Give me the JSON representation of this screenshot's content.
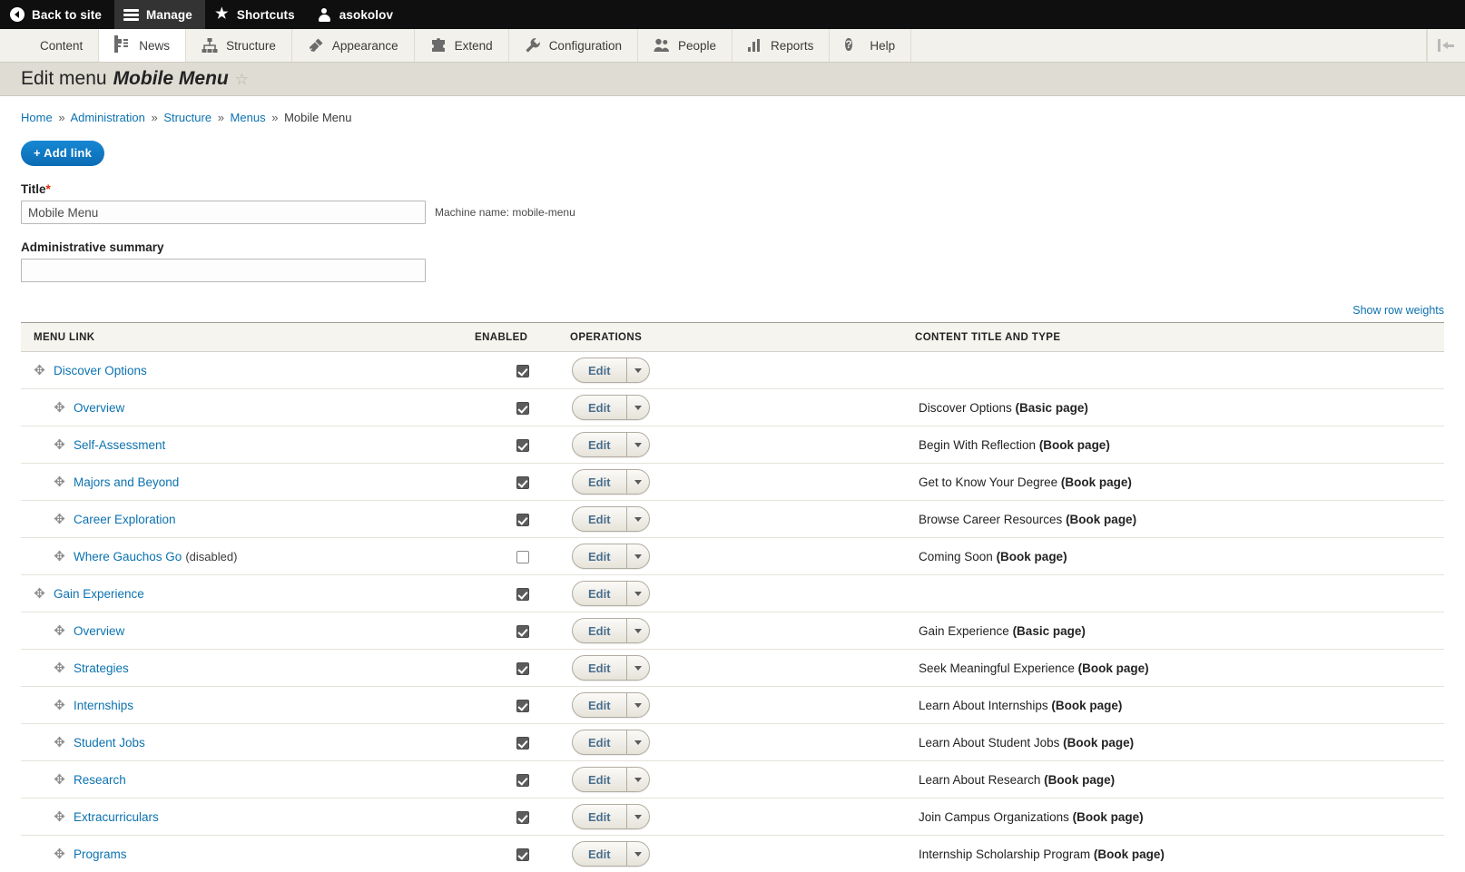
{
  "toolbar": {
    "back_to_site": "Back to site",
    "manage": "Manage",
    "shortcuts": "Shortcuts",
    "user": "asokolov"
  },
  "admin_menu": [
    {
      "label": "Content",
      "icon": "document-icon"
    },
    {
      "label": "News",
      "icon": "news-icon"
    },
    {
      "label": "Structure",
      "icon": "structure-icon"
    },
    {
      "label": "Appearance",
      "icon": "paintbrush-icon"
    },
    {
      "label": "Extend",
      "icon": "puzzle-icon"
    },
    {
      "label": "Configuration",
      "icon": "wrench-icon"
    },
    {
      "label": "People",
      "icon": "people-icon"
    },
    {
      "label": "Reports",
      "icon": "bar-chart-icon"
    },
    {
      "label": "Help",
      "icon": "help-icon"
    }
  ],
  "page": {
    "title_prefix": "Edit menu",
    "title_name": "Mobile Menu",
    "star": "☆"
  },
  "breadcrumb": [
    {
      "label": "Home",
      "link": true
    },
    {
      "label": "Administration",
      "link": true
    },
    {
      "label": "Structure",
      "link": true
    },
    {
      "label": "Menus",
      "link": true
    },
    {
      "label": "Mobile Menu",
      "link": false
    }
  ],
  "breadcrumb_separator": "»",
  "actions": {
    "add_link": "+ Add link"
  },
  "form": {
    "title_label": "Title",
    "title_required": "*",
    "title_value": "Mobile Menu",
    "machine_name": "Machine name: mobile-menu",
    "summary_label": "Administrative summary",
    "summary_value": "",
    "summary_placeholder": ""
  },
  "show_row_weights": "Show row weights",
  "table": {
    "headers": [
      "MENU LINK",
      "ENABLED",
      "OPERATIONS",
      "CONTENT TITLE AND TYPE"
    ],
    "edit_label": "Edit",
    "rows": [
      {
        "label": "Discover Options",
        "suffix": "",
        "indent": 0,
        "enabled": true,
        "content_title": "",
        "content_type": ""
      },
      {
        "label": "Overview",
        "suffix": "",
        "indent": 1,
        "enabled": true,
        "content_title": "Discover Options",
        "content_type": "(Basic page)"
      },
      {
        "label": "Self-Assessment",
        "suffix": "",
        "indent": 1,
        "enabled": true,
        "content_title": "Begin With Reflection",
        "content_type": "(Book page)"
      },
      {
        "label": "Majors and Beyond",
        "suffix": "",
        "indent": 1,
        "enabled": true,
        "content_title": "Get to Know Your Degree",
        "content_type": "(Book page)"
      },
      {
        "label": "Career Exploration",
        "suffix": "",
        "indent": 1,
        "enabled": true,
        "content_title": "Browse Career Resources",
        "content_type": "(Book page)"
      },
      {
        "label": "Where Gauchos Go",
        "suffix": "(disabled)",
        "indent": 1,
        "enabled": false,
        "content_title": "Coming Soon",
        "content_type": "(Book page)"
      },
      {
        "label": "Gain Experience",
        "suffix": "",
        "indent": 0,
        "enabled": true,
        "content_title": "",
        "content_type": ""
      },
      {
        "label": "Overview",
        "suffix": "",
        "indent": 1,
        "enabled": true,
        "content_title": "Gain Experience",
        "content_type": "(Basic page)"
      },
      {
        "label": "Strategies",
        "suffix": "",
        "indent": 1,
        "enabled": true,
        "content_title": "Seek Meaningful Experience",
        "content_type": "(Book page)"
      },
      {
        "label": "Internships",
        "suffix": "",
        "indent": 1,
        "enabled": true,
        "content_title": "Learn About Internships",
        "content_type": "(Book page)"
      },
      {
        "label": "Student Jobs",
        "suffix": "",
        "indent": 1,
        "enabled": true,
        "content_title": "Learn About Student Jobs",
        "content_type": "(Book page)"
      },
      {
        "label": "Research",
        "suffix": "",
        "indent": 1,
        "enabled": true,
        "content_title": "Learn About Research",
        "content_type": "(Book page)"
      },
      {
        "label": "Extracurriculars",
        "suffix": "",
        "indent": 1,
        "enabled": true,
        "content_title": "Join Campus Organizations",
        "content_type": "(Book page)"
      },
      {
        "label": "Programs",
        "suffix": "",
        "indent": 1,
        "enabled": true,
        "content_title": "Internship Scholarship Program",
        "content_type": "(Book page)"
      }
    ]
  },
  "colors": {
    "accent": "#0c72b0",
    "button": "#0f78c4",
    "toolbar_bg": "#0f0f0f",
    "required": "#e32700"
  },
  "drag_handle_glyph": "✥"
}
